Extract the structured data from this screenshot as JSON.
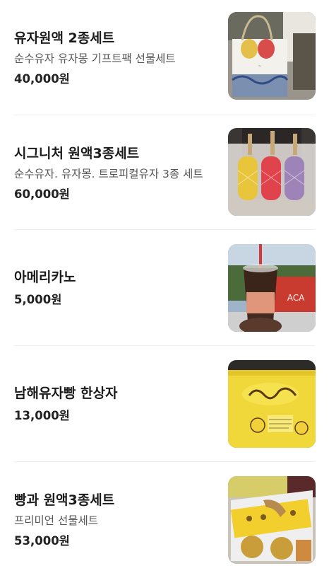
{
  "menu": {
    "items": [
      {
        "name": "유자원액 2종세트",
        "description": "순수유자 유자몽 기프트팩 선물세트",
        "price": "40,000원",
        "image": "gift-bag-photo"
      },
      {
        "name": "시그니처 원액3종세트",
        "description": "순수유자. 유자몽. 트로피컬유자 3종 세트",
        "price": "60,000원",
        "image": "three-bottles-photo"
      },
      {
        "name": "아메리카노",
        "description": "",
        "price": "5,000원",
        "image": "iced-americano-photo"
      },
      {
        "name": "남해유자빵 한상자",
        "description": "",
        "price": "13,000원",
        "image": "yuja-bread-box-photo"
      },
      {
        "name": "빵과 원액3종세트",
        "description": "프리미언 선물세트",
        "price": "53,000원",
        "image": "bread-and-juice-set-photo"
      }
    ]
  }
}
